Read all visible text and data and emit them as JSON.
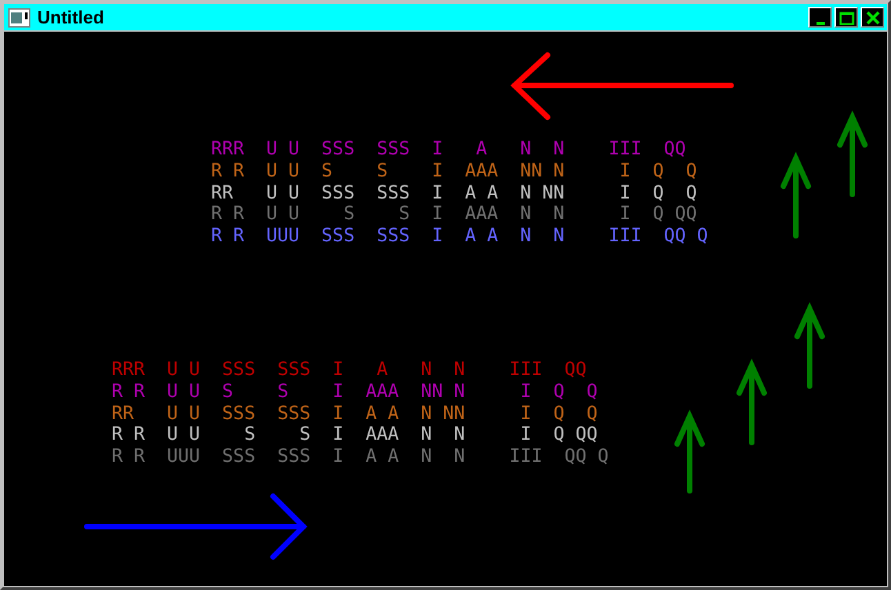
{
  "window": {
    "title": "Untitled"
  },
  "banners": [
    {
      "lines": [
        {
          "text": "RRR  U U  SSS  SSS  I   A   N  N    III  QQ",
          "color": "#b000b0"
        },
        {
          "text": "R R  U U  S    S    I  AAA  NN N     I  Q  Q",
          "color": "#c06418"
        },
        {
          "text": "RR   U U  SSS  SSS  I  A A  N NN     I  Q  Q",
          "color": "#c0c0c0"
        },
        {
          "text": "R R  U U    S    S  I  AAA  N  N     I  Q QQ",
          "color": "#707070"
        },
        {
          "text": "R R  UUU  SSS  SSS  I  A A  N  N    III  QQ Q",
          "color": "#6464ff"
        }
      ]
    },
    {
      "lines": [
        {
          "text": "RRR  U U  SSS  SSS  I   A   N  N    III  QQ",
          "color": "#c00000"
        },
        {
          "text": "R R  U U  S    S    I  AAA  NN N     I  Q  Q",
          "color": "#b000b0"
        },
        {
          "text": "RR   U U  SSS  SSS  I  A A  N NN     I  Q  Q",
          "color": "#c06418"
        },
        {
          "text": "R R  U U    S    S  I  AAA  N  N     I  Q QQ",
          "color": "#c0c0c0"
        },
        {
          "text": "R R  UUU  SSS  SSS  I  A A  N  N    III  QQ Q",
          "color": "#707070"
        }
      ]
    }
  ]
}
